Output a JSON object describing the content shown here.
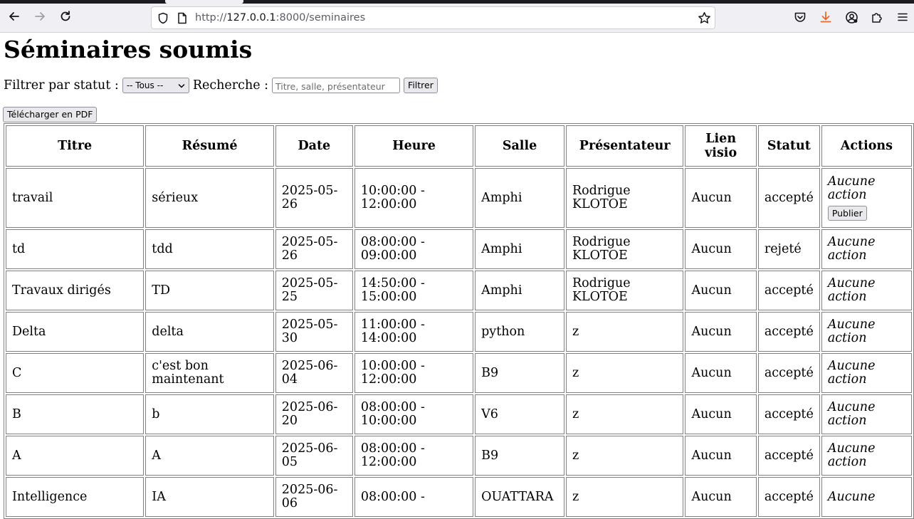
{
  "browser": {
    "url_prefix": "http://",
    "url_host": "127.0.0.1",
    "url_rest": ":8000/seminaires"
  },
  "page": {
    "title": "Séminaires soumis",
    "filter_label": "Filtrer par statut :",
    "filter_selected": "-- Tous --",
    "search_label": "Recherche :",
    "search_placeholder": "Titre, salle, présentateur",
    "filter_button": "Filtrer",
    "pdf_button": "Télécharger en PDF"
  },
  "table": {
    "headers": [
      "Titre",
      "Résumé",
      "Date",
      "Heure",
      "Salle",
      "Présentateur",
      "Lien visio",
      "Statut",
      "Actions"
    ],
    "rows": [
      {
        "titre": "travail",
        "resume": "sérieux",
        "date": "2025-05-26",
        "heure": "10:00:00 - 12:00:00",
        "salle": "Amphi",
        "presentateur": "Rodrigue KLOTOE",
        "lien": "Aucun",
        "statut": "accepté",
        "action": "Aucune action",
        "button": "Publier"
      },
      {
        "titre": "td",
        "resume": "tdd",
        "date": "2025-05-26",
        "heure": "08:00:00 - 09:00:00",
        "salle": "Amphi",
        "presentateur": "Rodrigue KLOTOE",
        "lien": "Aucun",
        "statut": "rejeté",
        "action": "Aucune action"
      },
      {
        "titre": "Travaux dirigés",
        "resume": "TD",
        "date": "2025-05-25",
        "heure": "14:50:00 - 15:00:00",
        "salle": "Amphi",
        "presentateur": "Rodrigue KLOTOE",
        "lien": "Aucun",
        "statut": "accepté",
        "action": "Aucune action"
      },
      {
        "titre": "Delta",
        "resume": "delta",
        "date": "2025-05-30",
        "heure": "11:00:00 - 14:00:00",
        "salle": "python",
        "presentateur": "z",
        "lien": "Aucun",
        "statut": "accepté",
        "action": "Aucune action"
      },
      {
        "titre": "C",
        "resume": "c'est bon maintenant",
        "date": "2025-06-04",
        "heure": "10:00:00 - 12:00:00",
        "salle": "B9",
        "presentateur": "z",
        "lien": "Aucun",
        "statut": "accepté",
        "action": "Aucune action"
      },
      {
        "titre": "B",
        "resume": "b",
        "date": "2025-06-20",
        "heure": "08:00:00 - 10:00:00",
        "salle": "V6",
        "presentateur": "z",
        "lien": "Aucun",
        "statut": "accepté",
        "action": "Aucune action"
      },
      {
        "titre": "A",
        "resume": "A",
        "date": "2025-06-05",
        "heure": "08:00:00 - 12:00:00",
        "salle": "B9",
        "presentateur": "z",
        "lien": "Aucun",
        "statut": "accepté",
        "action": "Aucune action"
      },
      {
        "titre": "Intelligence",
        "resume": "IA",
        "date": "2025-06-06",
        "heure": "08:00:00 -",
        "salle": "OUATTARA",
        "presentateur": "z",
        "lien": "Aucun",
        "statut": "accepté",
        "action": "Aucune"
      }
    ]
  }
}
